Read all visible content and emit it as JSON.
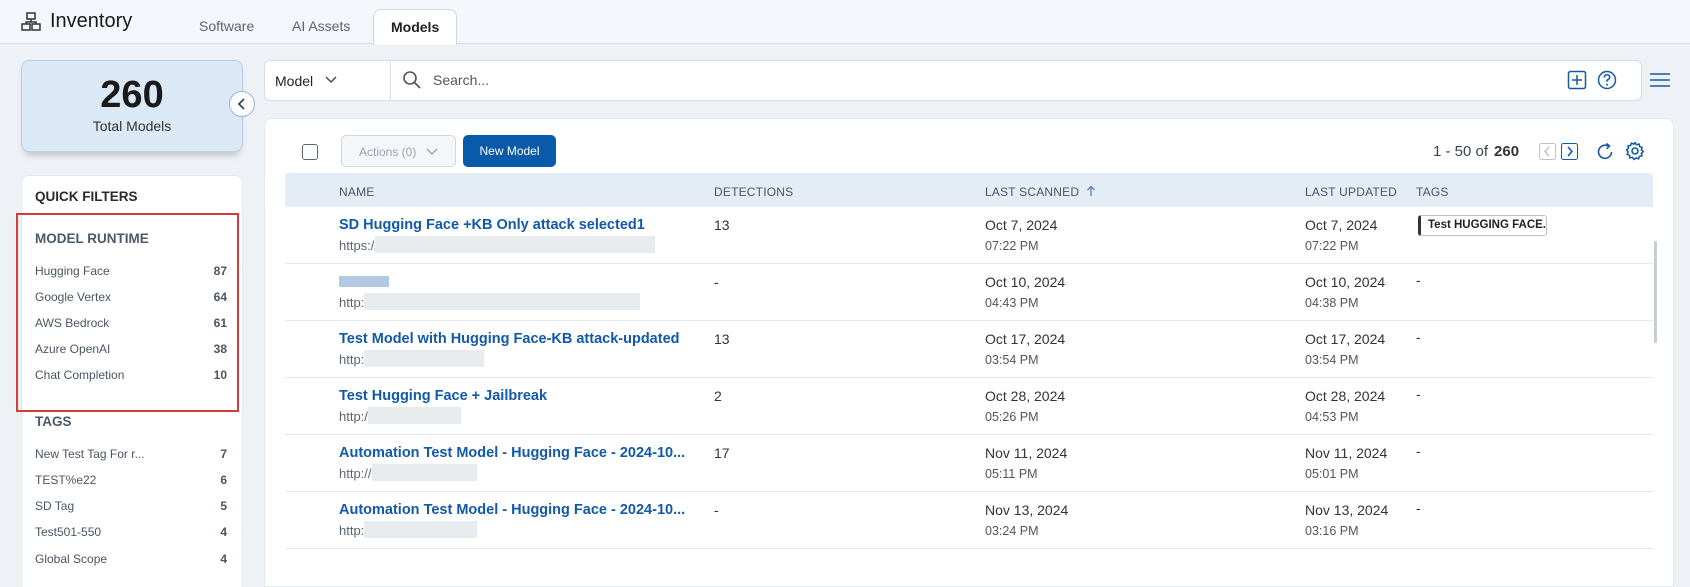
{
  "header": {
    "title": "Inventory",
    "tabs": [
      {
        "label": "Software"
      },
      {
        "label": "AI Assets"
      },
      {
        "label": "Models"
      }
    ]
  },
  "summary": {
    "count": "260",
    "label": "Total Models"
  },
  "quick_filters": {
    "title": "QUICK FILTERS",
    "runtime": {
      "title": "MODEL RUNTIME",
      "items": [
        {
          "label": "Hugging Face",
          "count": "87"
        },
        {
          "label": "Google Vertex",
          "count": "64"
        },
        {
          "label": "AWS Bedrock",
          "count": "61"
        },
        {
          "label": "Azure OpenAI",
          "count": "38"
        },
        {
          "label": "Chat Completion",
          "count": "10"
        }
      ]
    },
    "tags": {
      "title": "TAGS",
      "items": [
        {
          "label": "New Test Tag For r...",
          "count": "7"
        },
        {
          "label": "TEST%e22",
          "count": "6"
        },
        {
          "label": "SD Tag",
          "count": "5"
        },
        {
          "label": "Test501-550",
          "count": "4"
        },
        {
          "label": "Global Scope",
          "count": "4"
        }
      ]
    }
  },
  "search": {
    "scope": "Model",
    "placeholder": "Search..."
  },
  "toolbar": {
    "actions_label": "Actions (0)",
    "new_label": "New Model",
    "range": "1 - 50 of",
    "total": "260"
  },
  "table": {
    "columns": {
      "name": "NAME",
      "detections": "DETECTIONS",
      "last_scanned": "LAST SCANNED",
      "last_updated": "LAST UPDATED",
      "tags": "TAGS"
    },
    "rows": [
      {
        "name": "SD Hugging Face +KB Only attack selected1",
        "url": "https://",
        "detections": "13",
        "scanned_date": "Oct 7, 2024",
        "scanned_time": "07:22 PM",
        "updated_date": "Oct 7, 2024",
        "updated_time": "07:22 PM",
        "tag": "Test HUGGING FACE..."
      },
      {
        "name": "",
        "url": "http:/",
        "detections": "-",
        "scanned_date": "Oct 10, 2024",
        "scanned_time": "04:43 PM",
        "updated_date": "Oct 10, 2024",
        "updated_time": "04:38 PM",
        "tag": "-"
      },
      {
        "name": "Test Model with Hugging Face-KB attack-updated",
        "url": "http:",
        "detections": "13",
        "scanned_date": "Oct 17, 2024",
        "scanned_time": "03:54 PM",
        "updated_date": "Oct 17, 2024",
        "updated_time": "03:54 PM",
        "tag": "-"
      },
      {
        "name": "Test Hugging Face + Jailbreak",
        "url": "http:/",
        "detections": "2",
        "scanned_date": "Oct 28, 2024",
        "scanned_time": "05:26 PM",
        "updated_date": "Oct 28, 2024",
        "updated_time": "04:53 PM",
        "tag": "-"
      },
      {
        "name": "Automation Test Model - Hugging Face - 2024-10...",
        "url": "http://",
        "detections": "17",
        "scanned_date": "Nov 11, 2024",
        "scanned_time": "05:11 PM",
        "updated_date": "Nov 11, 2024",
        "updated_time": "05:01 PM",
        "tag": "-"
      },
      {
        "name": "Automation Test Model - Hugging Face - 2024-10...",
        "url": "http:",
        "detections": "-",
        "scanned_date": "Nov 13, 2024",
        "scanned_time": "03:24 PM",
        "updated_date": "Nov 13, 2024",
        "updated_time": "03:16 PM",
        "tag": "-"
      }
    ]
  },
  "colors": {
    "accent": "#0a5aaa",
    "link": "#1259a8",
    "highlight": "#d63b3b",
    "summary_bg": "#dbe8f5"
  }
}
